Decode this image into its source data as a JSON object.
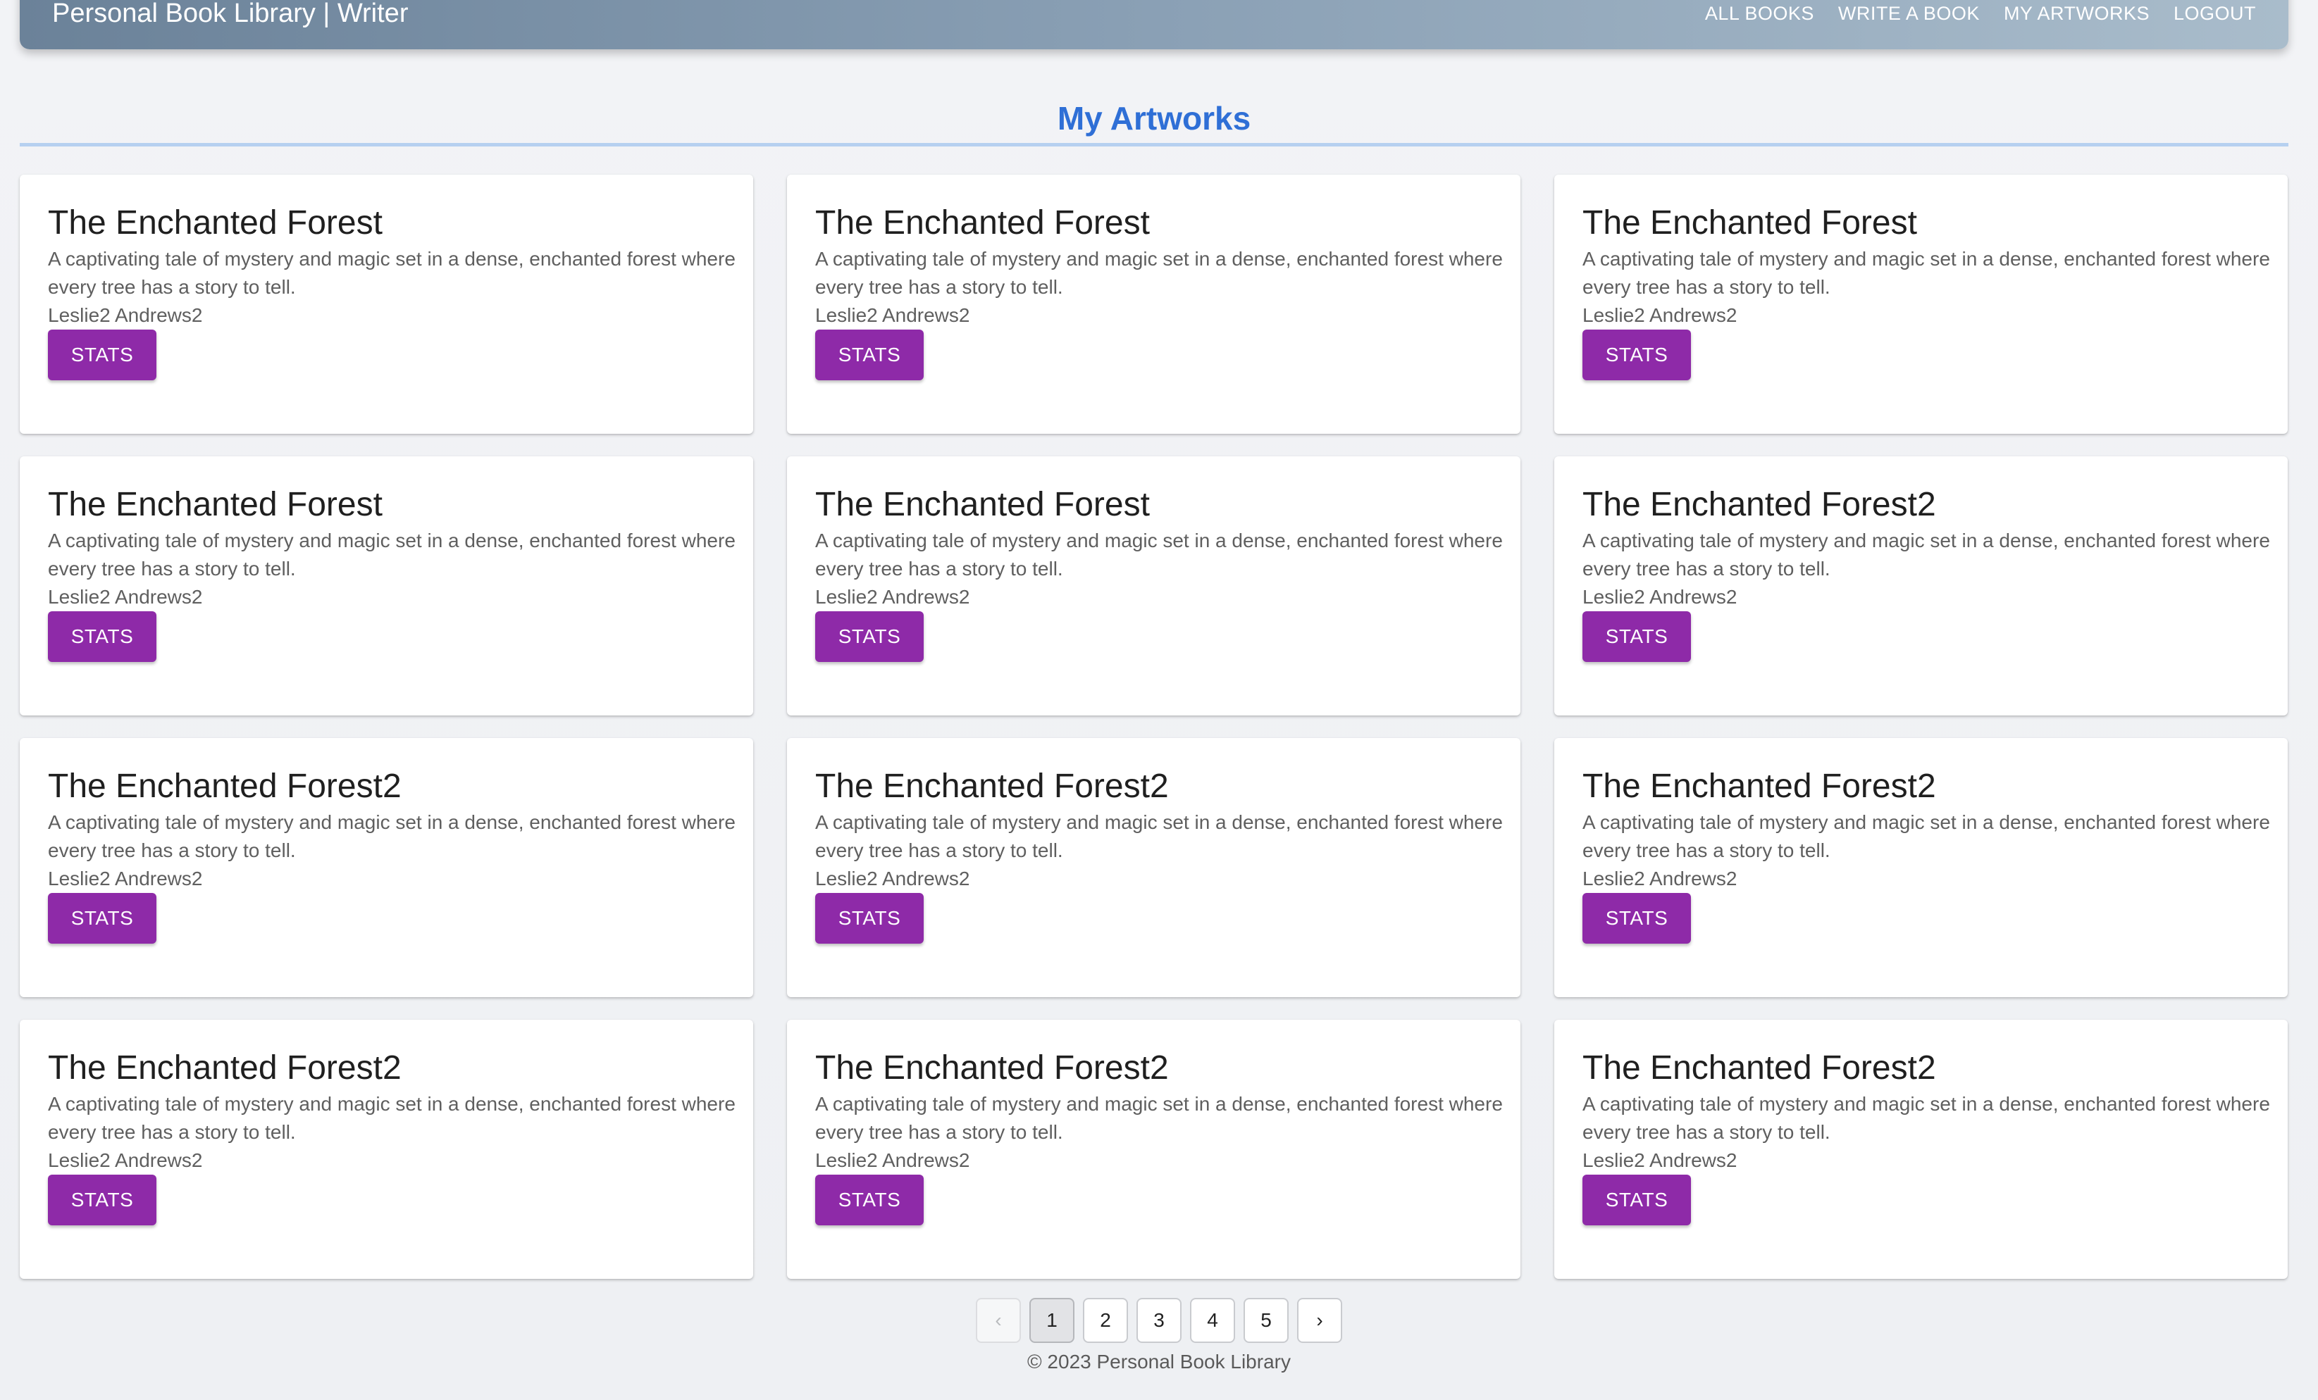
{
  "header": {
    "title": "Personal Book Library | Writer",
    "nav": [
      "ALL BOOKS",
      "WRITE A BOOK",
      "MY ARTWORKS",
      "LOGOUT"
    ]
  },
  "section": {
    "title": "My Artworks"
  },
  "cards": [
    {
      "title": "The Enchanted Forest",
      "description": "A captivating tale of mystery and magic set in a dense, enchanted forest where every tree has a story to tell.",
      "author": "Leslie2 Andrews2",
      "button": "STATS"
    },
    {
      "title": "The Enchanted Forest",
      "description": "A captivating tale of mystery and magic set in a dense, enchanted forest where every tree has a story to tell.",
      "author": "Leslie2 Andrews2",
      "button": "STATS"
    },
    {
      "title": "The Enchanted Forest",
      "description": "A captivating tale of mystery and magic set in a dense, enchanted forest where every tree has a story to tell.",
      "author": "Leslie2 Andrews2",
      "button": "STATS"
    },
    {
      "title": "The Enchanted Forest",
      "description": "A captivating tale of mystery and magic set in a dense, enchanted forest where every tree has a story to tell.",
      "author": "Leslie2 Andrews2",
      "button": "STATS"
    },
    {
      "title": "The Enchanted Forest",
      "description": "A captivating tale of mystery and magic set in a dense, enchanted forest where every tree has a story to tell.",
      "author": "Leslie2 Andrews2",
      "button": "STATS"
    },
    {
      "title": "The Enchanted Forest2",
      "description": "A captivating tale of mystery and magic set in a dense, enchanted forest where every tree has a story to tell.",
      "author": "Leslie2 Andrews2",
      "button": "STATS"
    },
    {
      "title": "The Enchanted Forest2",
      "description": "A captivating tale of mystery and magic set in a dense, enchanted forest where every tree has a story to tell.",
      "author": "Leslie2 Andrews2",
      "button": "STATS"
    },
    {
      "title": "The Enchanted Forest2",
      "description": "A captivating tale of mystery and magic set in a dense, enchanted forest where every tree has a story to tell.",
      "author": "Leslie2 Andrews2",
      "button": "STATS"
    },
    {
      "title": "The Enchanted Forest2",
      "description": "A captivating tale of mystery and magic set in a dense, enchanted forest where every tree has a story to tell.",
      "author": "Leslie2 Andrews2",
      "button": "STATS"
    },
    {
      "title": "The Enchanted Forest2",
      "description": "A captivating tale of mystery and magic set in a dense, enchanted forest where every tree has a story to tell.",
      "author": "Leslie2 Andrews2",
      "button": "STATS"
    },
    {
      "title": "The Enchanted Forest2",
      "description": "A captivating tale of mystery and magic set in a dense, enchanted forest where every tree has a story to tell.",
      "author": "Leslie2 Andrews2",
      "button": "STATS"
    },
    {
      "title": "The Enchanted Forest2",
      "description": "A captivating tale of mystery and magic set in a dense, enchanted forest where every tree has a story to tell.",
      "author": "Leslie2 Andrews2",
      "button": "STATS"
    }
  ],
  "pagination": {
    "prev_icon": "chevron-left-icon",
    "next_icon": "chevron-right-icon",
    "pages": [
      "1",
      "2",
      "3",
      "4",
      "5"
    ],
    "current": "1",
    "prev_glyph": "‹",
    "next_glyph": "›"
  },
  "footer": {
    "text": "© 2023 Personal Book Library"
  },
  "colors": {
    "accent_title": "#2f6fd6",
    "button": "#8e2aa8",
    "header_gradient_start": "#6b8299",
    "header_gradient_end": "#a9bccb"
  }
}
